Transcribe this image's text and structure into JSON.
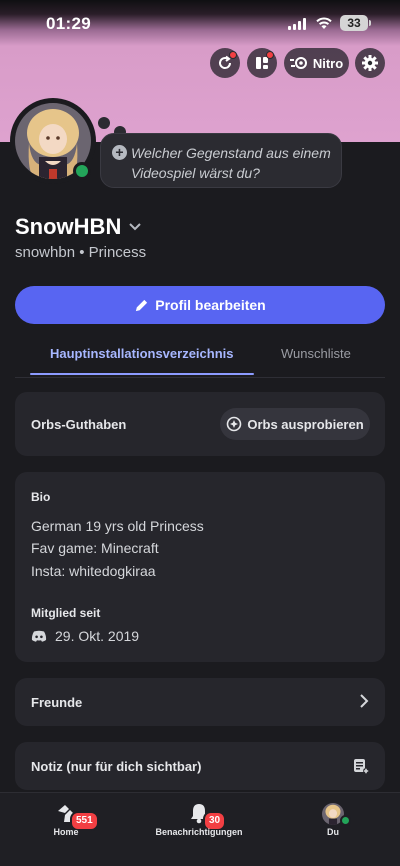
{
  "status_bar": {
    "time": "01:29",
    "battery": "33"
  },
  "top_actions": {
    "nitro_label": "Nitro"
  },
  "profile": {
    "status_bubble": "Welcher Gegenstand aus einem Videospiel wärst du?",
    "display_name": "SnowHBN",
    "handle": "snowhbn • Princess",
    "edit_button": "Profil bearbeiten"
  },
  "tabs": [
    {
      "label": "Hauptinstallationsverzeichnis",
      "active": true
    },
    {
      "label": "Wunschliste",
      "active": false
    }
  ],
  "orbs": {
    "title": "Orbs-Guthaben",
    "button": "Orbs ausprobieren"
  },
  "bio": {
    "heading": "Bio",
    "lines": [
      "German 19 yrs old Princess",
      "Fav game: Minecraft",
      "Insta: whitedogkiraa"
    ],
    "member_since_label": "Mitglied seit",
    "member_since_date": "29. Okt. 2019"
  },
  "friends": {
    "label": "Freunde"
  },
  "note": {
    "label": "Notiz (nur für dich sichtbar)"
  },
  "bottom_nav": [
    {
      "label": "Home",
      "badge": "551"
    },
    {
      "label": "Benachrichtigungen",
      "badge": "30"
    },
    {
      "label": "Du"
    }
  ],
  "colors": {
    "accent": "#5865f2",
    "online": "#23a55a",
    "badge": "#f23f43",
    "banner": "#dea2cf"
  }
}
